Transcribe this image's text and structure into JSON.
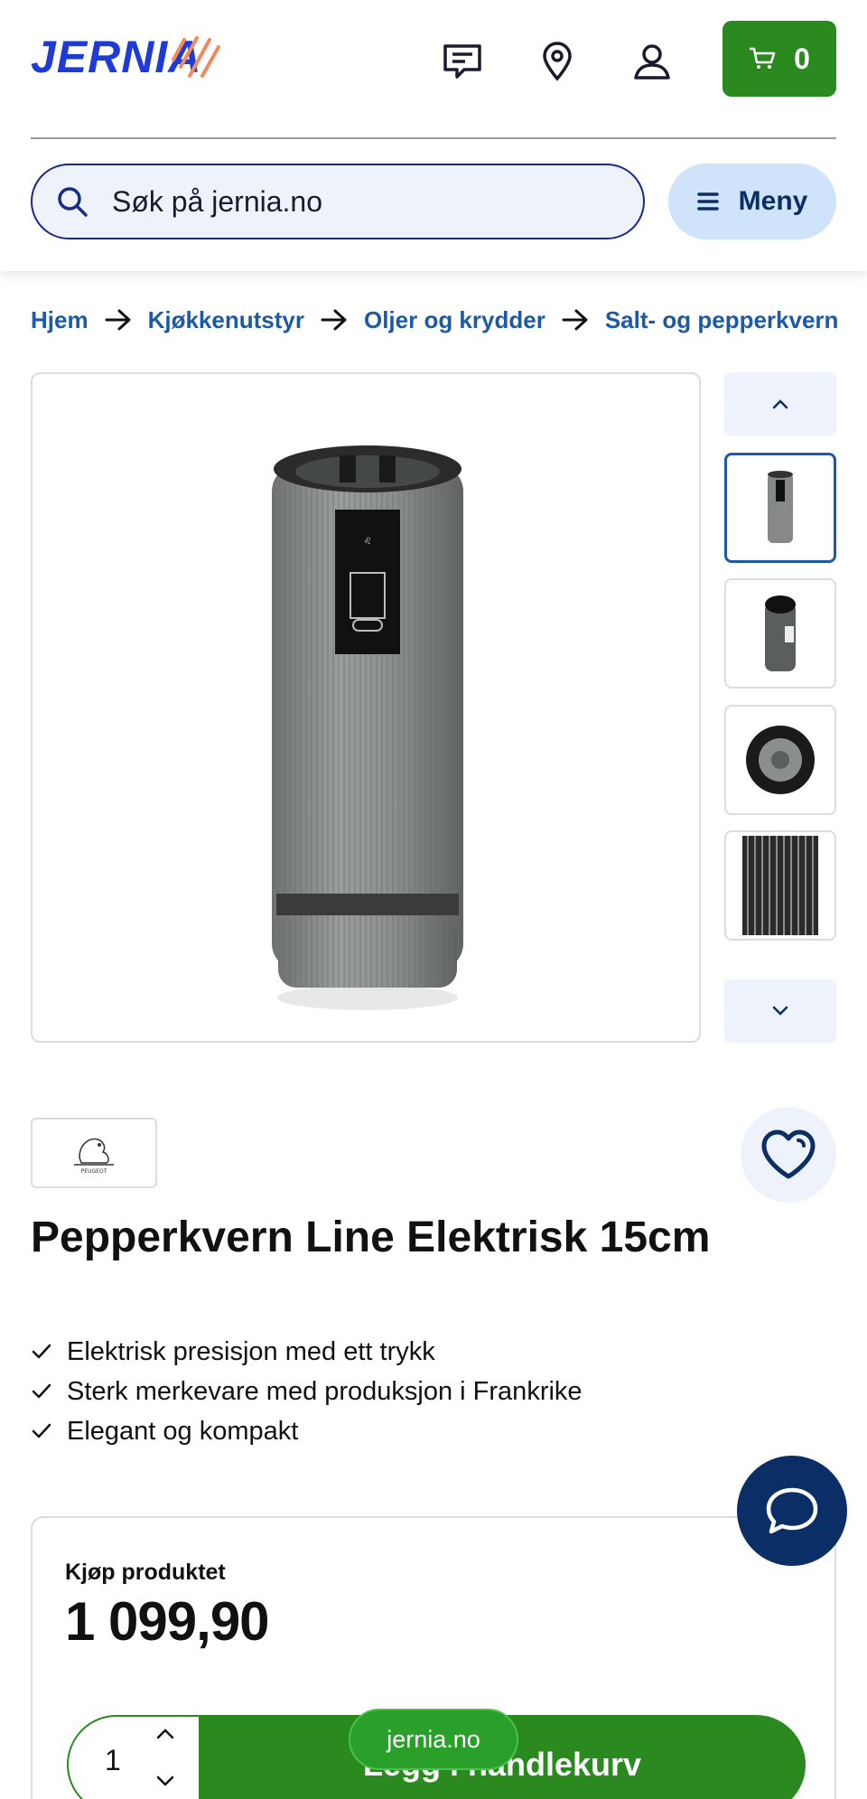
{
  "header": {
    "logo_text": "JERNIA",
    "cart_count": "0",
    "search_placeholder": "Søk på jernia.no",
    "menu_label": "Meny",
    "icons": [
      "chat-icon",
      "location-icon",
      "user-icon",
      "cart-icon",
      "search-icon",
      "menu-icon"
    ]
  },
  "breadcrumb": [
    "Hjem",
    "Kjøkkenutstyr",
    "Oljer og krydder",
    "Salt- og pepperkvern"
  ],
  "gallery": {
    "thumbnail_count": 4,
    "active_index": 0
  },
  "product": {
    "brand": "PEUGEOT",
    "title": "Pepperkvern Line Elektrisk 15cm",
    "features": [
      "Elektrisk presisjon med ett trykk",
      "Sterk merkevare med produksjon i Frankrike",
      "Elegant og kompakt"
    ]
  },
  "buy": {
    "label": "Kjøp produktet",
    "price": "1 099,90",
    "quantity": "1",
    "add_to_cart_label": "Legg i handlekurv"
  },
  "browser": {
    "domain": "jernia.no"
  },
  "colors": {
    "brand_blue": "#1f3bd6",
    "link_blue": "#1d5aa6",
    "navy": "#0b2e66",
    "green": "#2a8a1f"
  }
}
